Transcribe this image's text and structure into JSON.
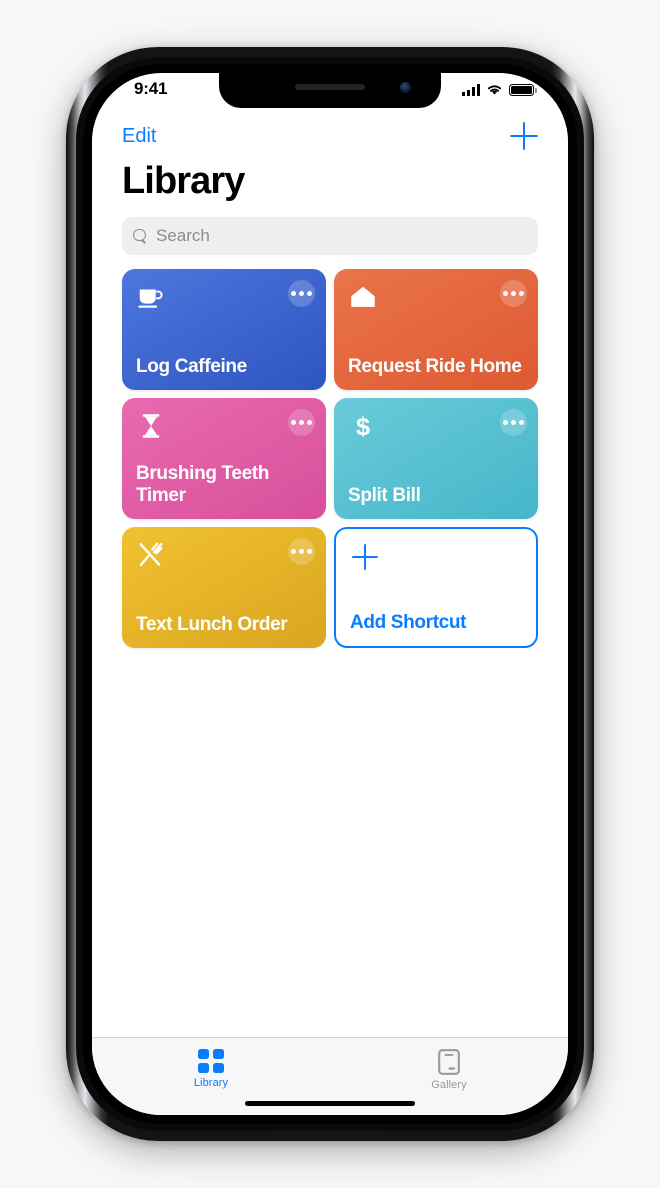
{
  "status_bar": {
    "time": "9:41",
    "icons": [
      "cellular-signal-icon",
      "wifi-icon",
      "battery-icon"
    ]
  },
  "nav": {
    "edit_label": "Edit",
    "add_icon": "plus-icon"
  },
  "header": {
    "title": "Library"
  },
  "search": {
    "placeholder": "Search",
    "value": "",
    "icon": "search-icon"
  },
  "shortcuts": [
    {
      "label": "Log Caffeine",
      "icon": "coffee-cup-icon",
      "color_start": "#4d76de",
      "color_end": "#2f55c0",
      "more_icon": "ellipsis-icon"
    },
    {
      "label": "Request Ride Home",
      "icon": "house-icon",
      "color_start": "#ea7449",
      "color_end": "#dd5a33",
      "more_icon": "ellipsis-icon"
    },
    {
      "label": "Brushing Teeth Timer",
      "icon": "hourglass-icon",
      "color_start": "#e96ab0",
      "color_end": "#d84f9b",
      "more_icon": "ellipsis-icon"
    },
    {
      "label": "Split Bill",
      "icon": "dollar-sign-icon",
      "color_start": "#69cbd8",
      "color_end": "#45b6ca",
      "more_icon": "ellipsis-icon"
    },
    {
      "label": "Text Lunch Order",
      "icon": "fork-knife-icon",
      "color_start": "#f0c230",
      "color_end": "#daa520",
      "more_icon": "ellipsis-icon"
    }
  ],
  "add_shortcut": {
    "label": "Add Shortcut",
    "icon": "plus-icon",
    "accent": "#0a7cff"
  },
  "tabs": [
    {
      "label": "Library",
      "icon": "grid-icon",
      "active": true
    },
    {
      "label": "Gallery",
      "icon": "device-icon",
      "active": false
    }
  ],
  "theme": {
    "accent": "#0a7cff",
    "background": "#f7f7f7",
    "search_field": "#efeff0",
    "inactive_tab": "#9a9a9e"
  }
}
